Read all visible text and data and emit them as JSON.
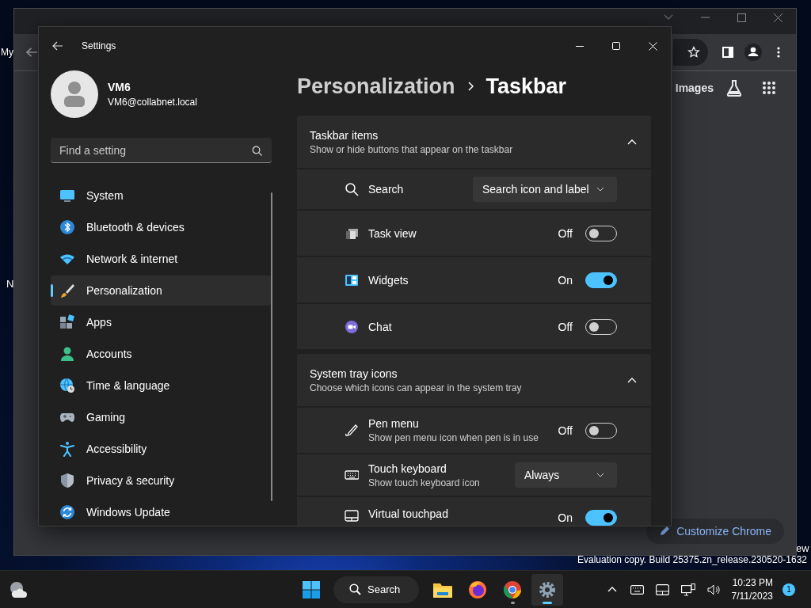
{
  "desktop": {
    "icon_labels": [
      "My",
      "N",
      "ew"
    ],
    "watermark": "Evaluation copy. Build 25375.zn_release.230520-1632"
  },
  "browser": {
    "links": [
      "Images"
    ],
    "customize_button": "Customize Chrome"
  },
  "settings": {
    "title": "Settings",
    "user": {
      "name": "VM6",
      "email": "VM6@collabnet.local"
    },
    "search": {
      "placeholder": "Find a setting"
    },
    "nav": [
      {
        "label": "System",
        "selected": false
      },
      {
        "label": "Bluetooth & devices",
        "selected": false
      },
      {
        "label": "Network & internet",
        "selected": false
      },
      {
        "label": "Personalization",
        "selected": true
      },
      {
        "label": "Apps",
        "selected": false
      },
      {
        "label": "Accounts",
        "selected": false
      },
      {
        "label": "Time & language",
        "selected": false
      },
      {
        "label": "Gaming",
        "selected": false
      },
      {
        "label": "Accessibility",
        "selected": false
      },
      {
        "label": "Privacy & security",
        "selected": false
      },
      {
        "label": "Windows Update",
        "selected": false
      }
    ],
    "breadcrumb": [
      "Personalization",
      "Taskbar"
    ],
    "sections": [
      {
        "title": "Taskbar items",
        "subtitle": "Show or hide buttons that appear on the taskbar",
        "expanded": true,
        "rows": [
          {
            "kind": "dropdown",
            "label": "Search",
            "value": "Search icon and label"
          },
          {
            "kind": "toggle",
            "label": "Task view",
            "on": false,
            "state_text": "Off"
          },
          {
            "kind": "toggle",
            "label": "Widgets",
            "on": true,
            "state_text": "On"
          },
          {
            "kind": "toggle",
            "label": "Chat",
            "on": false,
            "state_text": "Off"
          }
        ]
      },
      {
        "title": "System tray icons",
        "subtitle": "Choose which icons can appear in the system tray",
        "expanded": true,
        "rows": [
          {
            "kind": "toggle",
            "label": "Pen menu",
            "description": "Show pen menu icon when pen is in use",
            "on": false,
            "state_text": "Off"
          },
          {
            "kind": "dropdown",
            "label": "Touch keyboard",
            "description": "Show touch keyboard icon",
            "value": "Always"
          },
          {
            "kind": "toggle",
            "label": "Virtual touchpad",
            "on": true,
            "state_text": "On"
          }
        ]
      }
    ]
  },
  "taskbar": {
    "search_label": "Search",
    "time": "10:23 PM",
    "date": "7/11/2023",
    "notification_count": "1"
  }
}
